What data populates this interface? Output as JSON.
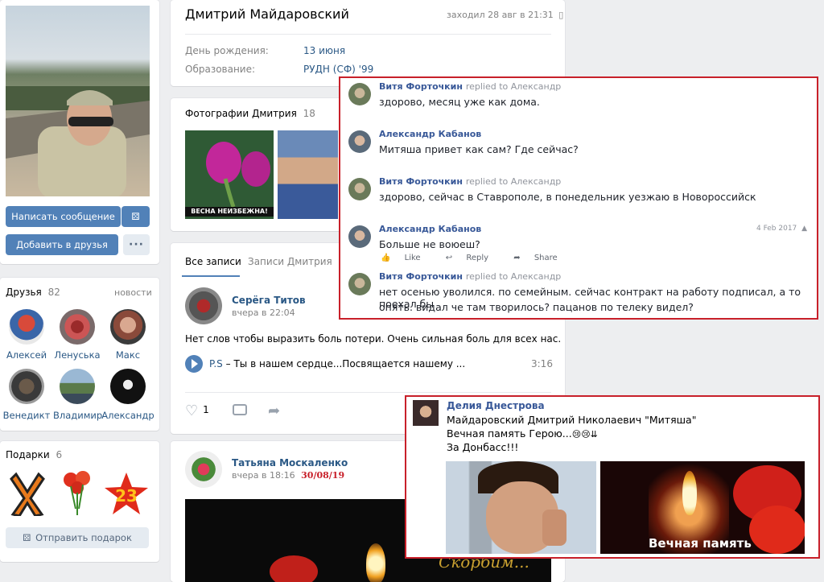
{
  "profile": {
    "name": "Дмитрий Майдаровский",
    "last_seen": "заходил 28 авг в 21:31",
    "info": [
      {
        "label": "День рождения:",
        "value": "13 июня"
      },
      {
        "label": "Образование:",
        "value": "РУДН (СФ) '99"
      }
    ],
    "write_button": "Написать сообщение",
    "add_friend_button": "Добавить в друзья"
  },
  "friends": {
    "title": "Друзья",
    "count": "82",
    "news_link": "новости",
    "items": [
      "Алексей",
      "Ленуська",
      "Макс",
      "Венедикт",
      "Владимир",
      "Александр"
    ]
  },
  "gifts": {
    "title": "Подарки",
    "count": "6",
    "send_button": "Отправить подарок",
    "gift3_text": "23"
  },
  "photos": {
    "title": "Фотографии Дмитрия",
    "count": "18",
    "caption": "ВЕСНА НЕИЗБЕЖНА!"
  },
  "wall": {
    "tabs": [
      "Все записи",
      "Записи Дмитрия"
    ],
    "post1": {
      "author": "Серёга Титов",
      "time": "вчера в 22:04",
      "text": "Нет слов чтобы выразить боль потери. Очень сильная боль для всех нас.",
      "audio_artist": "P.S",
      "audio_title": "Ты в нашем сердце...Посвящается нашему ...",
      "audio_duration": "3:16",
      "likes": "1"
    },
    "post2": {
      "author": "Татьяна Москаленко",
      "time": "вчера в 18:16",
      "date_red": "30/08/19",
      "image_text": "Скорбим..."
    }
  },
  "comments_overlay": {
    "comments": [
      {
        "author": "Витя Форточкин",
        "replied": "replied to Александр",
        "text": "здорово, месяц уже как дома."
      },
      {
        "author": "Александр Кабанов",
        "replied": "",
        "text": "Митяша привет как сам? Где сейчас?"
      },
      {
        "author": "Витя Форточкин",
        "replied": "replied to Александр",
        "text": "здорово, сейчас в Ставрополе, в понедельник уезжаю в Новороссийск"
      },
      {
        "author": "Александр Кабанов",
        "replied": "",
        "text": "Больше не воюеш?",
        "date": "4 Feb 2017"
      },
      {
        "author": "Витя Форточкин",
        "replied": "replied to Александр",
        "text_line1": "нет осенью уволился. по семейным. сейчас контракт на работу подписал, а то поехал бы",
        "text_line2": "опять. видал че там творилось? пацанов по телеку видел?"
      }
    ],
    "actions": {
      "like": "Like",
      "reply": "Reply",
      "share": "Share"
    }
  },
  "memorial_overlay": {
    "author": "Делия Днестрова",
    "line1": "Майдаровский Дмитрий Николаевич \"Митяша\"",
    "line2": "Вечная память Герою...",
    "line2_emoji": "😢😢⇊",
    "line3": "За Донбасс!!!",
    "image2_caption": "Вечная память"
  }
}
